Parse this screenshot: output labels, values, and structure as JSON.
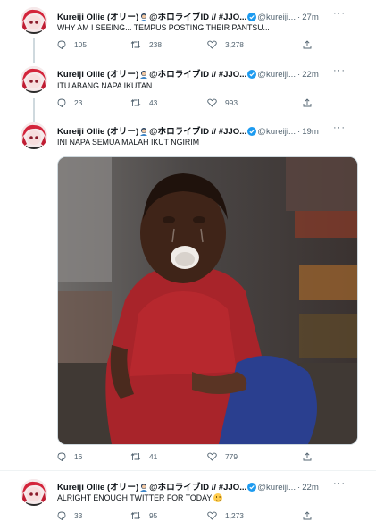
{
  "tweets": [
    {
      "author": "Kureiji Ollie (オリー)",
      "author_suffix": "@ホロライブID // #JJO...",
      "handle": "@kureiji...",
      "time": "27m",
      "text": "WHY AM I SEEING... TEMPUS POSTING THEIR PANTSU...",
      "replies": "105",
      "retweets": "238",
      "likes": "3,278"
    },
    {
      "author": "Kureiji Ollie (オリー)",
      "author_suffix": "@ホロライブID // #JJO...",
      "handle": "@kureiji...",
      "time": "22m",
      "text": "ITU ABANG NAPA IKUTAN",
      "replies": "23",
      "retweets": "43",
      "likes": "993"
    },
    {
      "author": "Kureiji Ollie (オリー)",
      "author_suffix": "@ホロライブID // #JJO...",
      "handle": "@kureiji...",
      "time": "19m",
      "text": "INI NAPA SEMUA MALAH IKUT NGIRIM",
      "replies": "16",
      "retweets": "41",
      "likes": "779"
    },
    {
      "author": "Kureiji Ollie (オリー)",
      "author_suffix": "@ホロライブID // #JJO...",
      "handle": "@kureiji...",
      "time": "22m",
      "text": "ALRIGHT ENOUGH TWITTER FOR TODAY",
      "replies": "33",
      "retweets": "95",
      "likes": "1,273"
    }
  ],
  "colors": {
    "verified": "#1d9bf0",
    "secondary_text": "#536471",
    "thread_line": "#cfd9de"
  }
}
